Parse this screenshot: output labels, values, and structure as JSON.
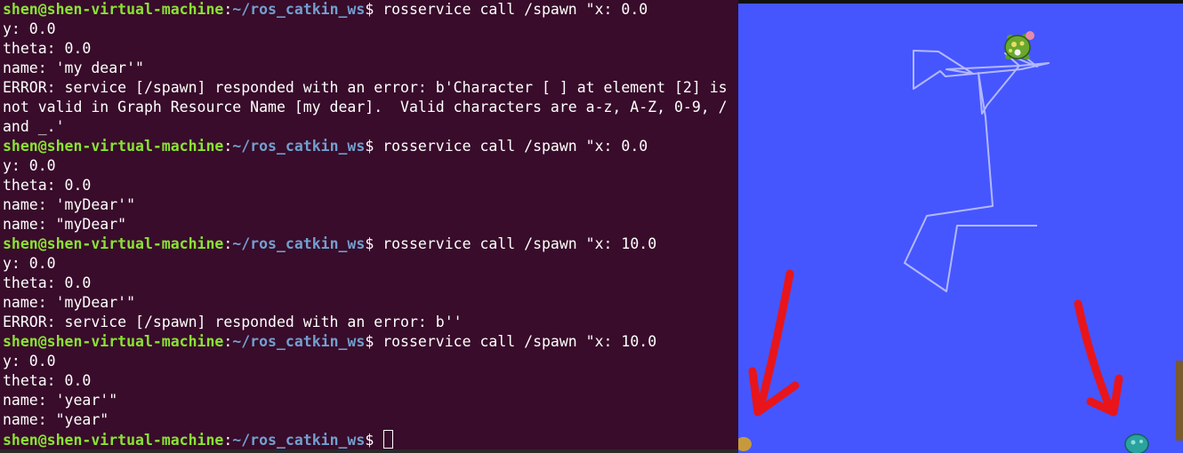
{
  "terminal": {
    "prompt": {
      "user": "shen@shen-virtual-machine",
      "sep": ":",
      "path": "~/ros_catkin_ws",
      "dollar": "$ "
    },
    "lines": [
      {
        "type": "prompt",
        "cmd": "rosservice call /spawn \"x: 0.0"
      },
      {
        "type": "out",
        "text": "y: 0.0"
      },
      {
        "type": "out",
        "text": "theta: 0.0"
      },
      {
        "type": "out",
        "text": "name: 'my dear'\""
      },
      {
        "type": "out",
        "text": "ERROR: service [/spawn] responded with an error: b'Character [ ] at element [2] is"
      },
      {
        "type": "out",
        "text": "not valid in Graph Resource Name [my dear].  Valid characters are a-z, A-Z, 0-9, /"
      },
      {
        "type": "out",
        "text": "and _.'"
      },
      {
        "type": "prompt",
        "cmd": "rosservice call /spawn \"x: 0.0"
      },
      {
        "type": "out",
        "text": "y: 0.0"
      },
      {
        "type": "out",
        "text": "theta: 0.0"
      },
      {
        "type": "out",
        "text": "name: 'myDear'\""
      },
      {
        "type": "out",
        "text": "name: \"myDear\""
      },
      {
        "type": "prompt",
        "cmd": "rosservice call /spawn \"x: 10.0"
      },
      {
        "type": "out",
        "text": "y: 0.0"
      },
      {
        "type": "out",
        "text": "theta: 0.0"
      },
      {
        "type": "out",
        "text": "name: 'myDear'\""
      },
      {
        "type": "out",
        "text": "ERROR: service [/spawn] responded with an error: b''"
      },
      {
        "type": "prompt",
        "cmd": "rosservice call /spawn \"x: 10.0"
      },
      {
        "type": "out",
        "text": "y: 0.0"
      },
      {
        "type": "out",
        "text": "theta: 0.0"
      },
      {
        "type": "out",
        "text": "name: 'year'\""
      },
      {
        "type": "out",
        "text": "name: \"year\""
      },
      {
        "type": "prompt",
        "cmd": "",
        "cursor": true
      }
    ]
  },
  "turtlesim": {
    "background": "#4556ff",
    "pen_color": "#b3b8ff",
    "arrow_color": "#e8151b",
    "icons": [
      "turtle-icon",
      "red-arrow-annotation"
    ]
  },
  "colors": {
    "terminal_bg": "#380c2a",
    "prompt_user": "#8ae234",
    "prompt_path": "#729fcf"
  }
}
